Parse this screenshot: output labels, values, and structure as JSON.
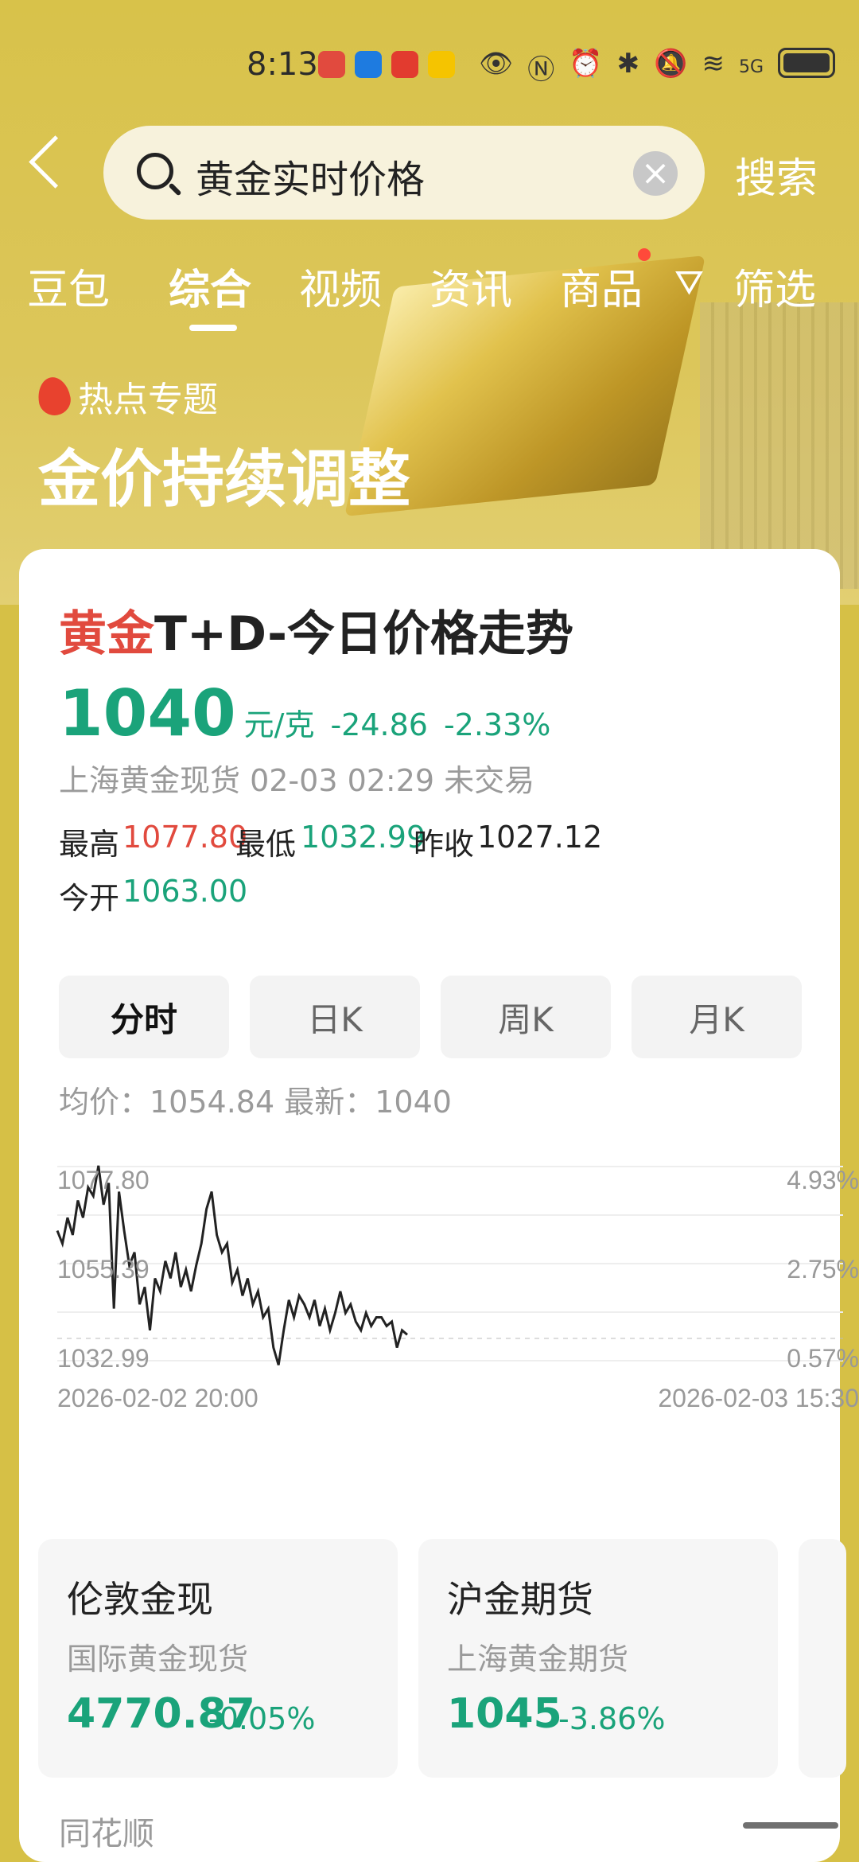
{
  "status_bar": {
    "time": "8:13",
    "network": "5G"
  },
  "search": {
    "query": "黄金实时价格",
    "button": "搜索"
  },
  "tabs": [
    "豆包",
    "综合",
    "视频",
    "资讯",
    "商品",
    "筛选"
  ],
  "hot_topic": {
    "label": "热点专题",
    "headline": "金价持续调整"
  },
  "card": {
    "title_red": "黄金",
    "title_rest": "T+D-今日价格走势",
    "price": "1040",
    "unit": "元/克",
    "change": "-24.86",
    "change_pct": "-2.33%",
    "subline": "上海黄金现货 02-03 02:29 未交易",
    "stats": {
      "high_label": "最高",
      "high": "1077.80",
      "low_label": "最低",
      "low": "1032.99",
      "prev_close_label": "昨收",
      "prev_close": "1027.12",
      "open_label": "今开",
      "open": "1063.00"
    },
    "k_tabs": [
      "分时",
      "日K",
      "周K",
      "月K"
    ],
    "avg_line": "均价：1054.84  最新：1040",
    "colors": {
      "up": "#e14a3e",
      "down": "#1aa37a"
    }
  },
  "chart_data": {
    "type": "line",
    "title": "",
    "xlabel": "",
    "ylabel": "",
    "x_start": "2026-02-02 20:00",
    "x_end": "2026-02-03 15:30",
    "y_ticks_left": [
      "1077.80",
      "1055.39",
      "1032.99"
    ],
    "y_ticks_right": [
      "4.93%",
      "2.75%",
      "0.57%"
    ],
    "ylim": [
      1032.99,
      1077.8
    ],
    "grid": true,
    "series": [
      {
        "values": [
          1063,
          1060,
          1066,
          1062,
          1070,
          1066,
          1073,
          1071,
          1078,
          1069,
          1074,
          1045,
          1072,
          1063,
          1055,
          1058,
          1046,
          1050,
          1040,
          1052,
          1049,
          1056,
          1052,
          1058,
          1050,
          1054,
          1049,
          1055,
          1060,
          1068,
          1072,
          1062,
          1058,
          1060,
          1051,
          1054,
          1048,
          1052,
          1046,
          1049,
          1043,
          1045,
          1036,
          1032,
          1040,
          1047,
          1043,
          1048,
          1046,
          1043,
          1047,
          1041,
          1045,
          1040,
          1044,
          1049,
          1044,
          1046,
          1042,
          1040,
          1044,
          1041,
          1043,
          1043,
          1041,
          1042,
          1036,
          1040,
          1039
        ]
      }
    ]
  },
  "markets": [
    {
      "name": "伦敦金现",
      "desc": "国际黄金现货",
      "value": "4770.87",
      "pct": "-0.05%"
    },
    {
      "name": "沪金期货",
      "desc": "上海黄金期货",
      "value": "1045",
      "pct": "-3.86%"
    }
  ],
  "source": "同花顺"
}
